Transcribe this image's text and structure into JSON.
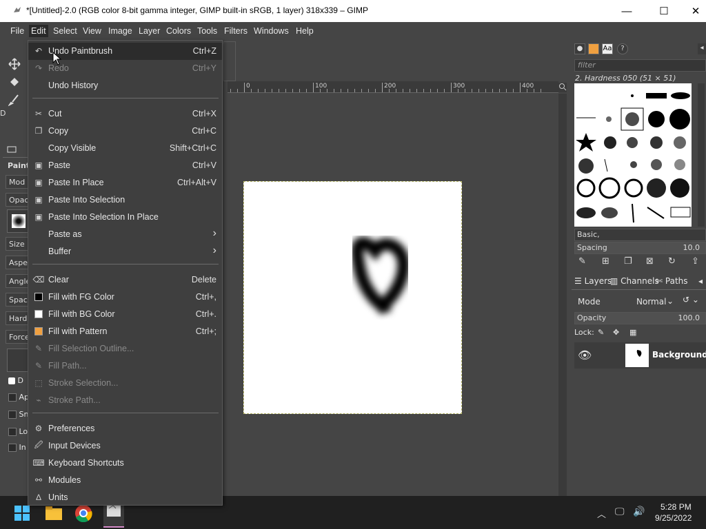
{
  "window": {
    "title": "*[Untitled]-2.0 (RGB color 8-bit gamma integer, GIMP built-in sRGB, 1 layer) 318x339 – GIMP",
    "minimize": "—",
    "maximize": "☐",
    "close": "✕"
  },
  "menubar": [
    "File",
    "Edit",
    "Select",
    "View",
    "Image",
    "Layer",
    "Colors",
    "Tools",
    "Filters",
    "Windows",
    "Help"
  ],
  "edit_menu": {
    "items": [
      {
        "label": "Undo Paintbrush",
        "shortcut": "Ctrl+Z",
        "icon": "undo-icon"
      },
      {
        "label": "Redo",
        "shortcut": "Ctrl+Y",
        "icon": "redo-icon"
      },
      {
        "label": "Undo History",
        "shortcut": "",
        "icon": ""
      },
      {
        "label": "Cut",
        "shortcut": "Ctrl+X",
        "icon": "scissors-icon"
      },
      {
        "label": "Copy",
        "shortcut": "Ctrl+C",
        "icon": "copy-icon"
      },
      {
        "label": "Copy Visible",
        "shortcut": "Shift+Ctrl+C",
        "icon": ""
      },
      {
        "label": "Paste",
        "shortcut": "Ctrl+V",
        "icon": "paste-icon"
      },
      {
        "label": "Paste In Place",
        "shortcut": "Ctrl+Alt+V",
        "icon": "paste-icon"
      },
      {
        "label": "Paste Into Selection",
        "shortcut": "",
        "icon": "paste-icon"
      },
      {
        "label": "Paste Into Selection In Place",
        "shortcut": "",
        "icon": "paste-icon"
      },
      {
        "label": "Paste as",
        "shortcut": "›",
        "icon": ""
      },
      {
        "label": "Buffer",
        "shortcut": "›",
        "icon": ""
      },
      {
        "label": "Clear",
        "shortcut": "Delete",
        "icon": "clear-icon"
      },
      {
        "label": "Fill with FG Color",
        "shortcut": "Ctrl+,",
        "icon": "fg-swatch-icon"
      },
      {
        "label": "Fill with BG Color",
        "shortcut": "Ctrl+.",
        "icon": "bg-swatch-icon"
      },
      {
        "label": "Fill with Pattern",
        "shortcut": "Ctrl+;",
        "icon": "pattern-swatch-icon"
      },
      {
        "label": "Fill Selection Outline...",
        "shortcut": "",
        "icon": "fill-outline-icon"
      },
      {
        "label": "Fill Path...",
        "shortcut": "",
        "icon": "fill-path-icon"
      },
      {
        "label": "Stroke Selection...",
        "shortcut": "",
        "icon": "stroke-selection-icon"
      },
      {
        "label": "Stroke Path...",
        "shortcut": "",
        "icon": "stroke-path-icon"
      },
      {
        "label": "Preferences",
        "shortcut": "",
        "icon": "preferences-icon"
      },
      {
        "label": "Input Devices",
        "shortcut": "",
        "icon": "input-devices-icon"
      },
      {
        "label": "Keyboard Shortcuts",
        "shortcut": "",
        "icon": "keyboard-icon"
      },
      {
        "label": "Modules",
        "shortcut": "",
        "icon": "modules-icon"
      },
      {
        "label": "Units",
        "shortcut": "",
        "icon": "units-icon"
      }
    ]
  },
  "toolbox": {
    "paint_label": "Paint",
    "mode": "Mod",
    "opacity": "Opac",
    "size": "Size",
    "aspect": "Aspe",
    "angle": "Angle",
    "spacing": "Spaci",
    "hardness": "Hardn",
    "force": "Force",
    "opt1": "D",
    "opt2": "Ap",
    "opt3": "Sn",
    "opt4": "Lo",
    "opt5": "In"
  },
  "ruler": [
    "0",
    "100",
    "200",
    "300",
    "400"
  ],
  "brushes": {
    "filter_placeholder": "filter",
    "current": "2. Hardness 050 (51 × 51)",
    "tag": "Basic,",
    "spacing_label": "Spacing",
    "spacing_value": "10.0"
  },
  "layers": {
    "tabs": [
      "Layers",
      "Channels",
      "Paths"
    ],
    "mode_label": "Mode",
    "mode_value": "Normal",
    "opacity_label": "Opacity",
    "opacity_value": "100.0",
    "lock_label": "Lock:",
    "layer_name": "Background"
  },
  "taskbar": {
    "time": "5:28 PM",
    "date": "9/25/2022"
  }
}
